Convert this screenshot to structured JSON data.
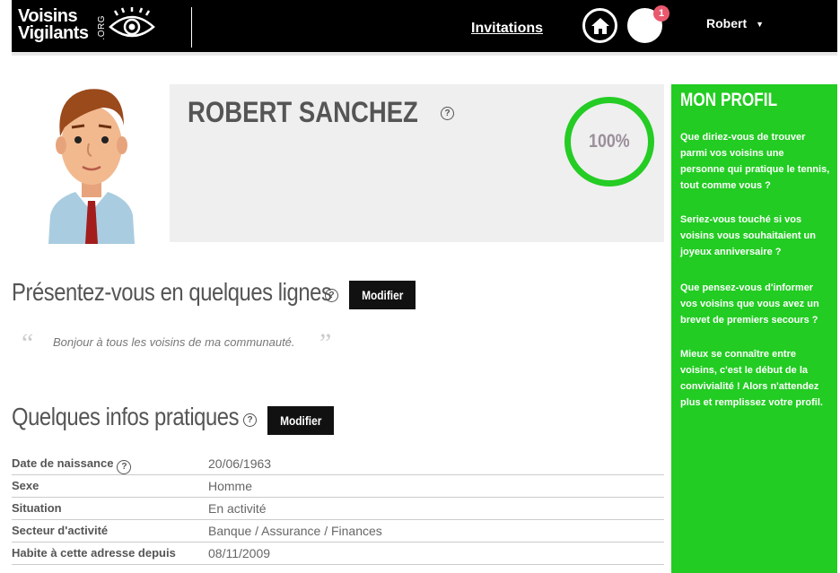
{
  "header": {
    "logo_line1": "Voisins",
    "logo_line2": "Vigilants",
    "logo_suffix": ".ORG",
    "nav_invitations": "Invitations",
    "notification_count": "1",
    "user_name": "Robert",
    "user_caret": "▼"
  },
  "profile": {
    "name": "ROBERT SANCHEZ",
    "completion": "100%",
    "help": "?"
  },
  "presentation": {
    "title": "Présentez-vous en quelques lignes",
    "help": "?",
    "button": "Modifier",
    "quote_open": "“",
    "text": "Bonjour à tous les voisins de ma communauté.",
    "quote_close": "”"
  },
  "infos": {
    "title": "Quelques infos pratiques",
    "help": "?",
    "button": "Modifier",
    "rows": [
      {
        "label": "Date de naissance",
        "value": "20/06/1963"
      },
      {
        "label": "Sexe",
        "value": "Homme"
      },
      {
        "label": "Situation",
        "value": "En activité"
      },
      {
        "label": "Secteur d'activité",
        "value": "Banque / Assurance / Finances"
      },
      {
        "label": "Habite à cette adresse depuis",
        "value": "08/11/2009"
      }
    ]
  },
  "sidebar": {
    "title": "MON PROFIL",
    "paragraphs": [
      "Que diriez-vous de trouver parmi vos voisins une personne qui pratique le tennis, tout comme vous ?",
      "Seriez-vous touché si vos voisins vous souhaitaient un joyeux anniversaire ?",
      "Que pensez-vous d'informer vos voisins que vous avez un brevet de premiers secours ?",
      "Mieux se connaître entre voisins, c'est le début de la convivialité ! Alors n'attendez plus et remplissez votre profil."
    ]
  },
  "colors": {
    "accent_green": "#22cc22",
    "header_bg": "#000000",
    "badge": "#e9596e"
  }
}
